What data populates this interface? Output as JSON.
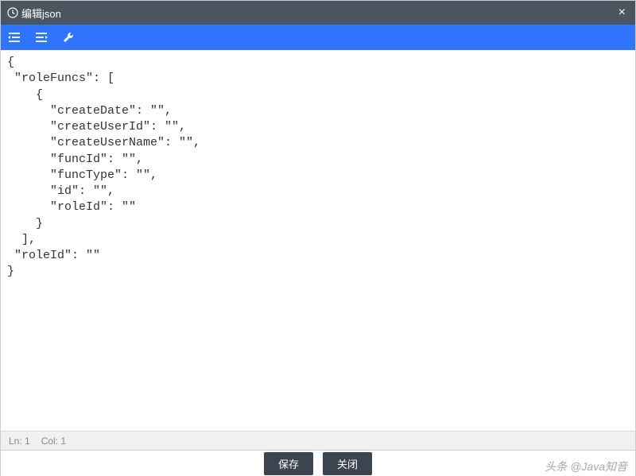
{
  "titlebar": {
    "title": "编辑json",
    "close_label": "×"
  },
  "toolbar": {
    "indent_left_icon": "indent-left",
    "indent_right_icon": "indent-right",
    "wrench_icon": "wrench"
  },
  "editor": {
    "content": "{\n \"roleFuncs\": [\n    {\n      \"createDate\": \"\",\n      \"createUserId\": \"\",\n      \"createUserName\": \"\",\n      \"funcId\": \"\",\n      \"funcType\": \"\",\n      \"id\": \"\",\n      \"roleId\": \"\"\n    }\n  ],\n \"roleId\": \"\"\n}"
  },
  "status": {
    "line_label": "Ln: 1",
    "col_label": "Col: 1"
  },
  "footer": {
    "save_label": "保存",
    "close_label": "关闭"
  },
  "watermark": {
    "text": "头条 @Java知音"
  }
}
